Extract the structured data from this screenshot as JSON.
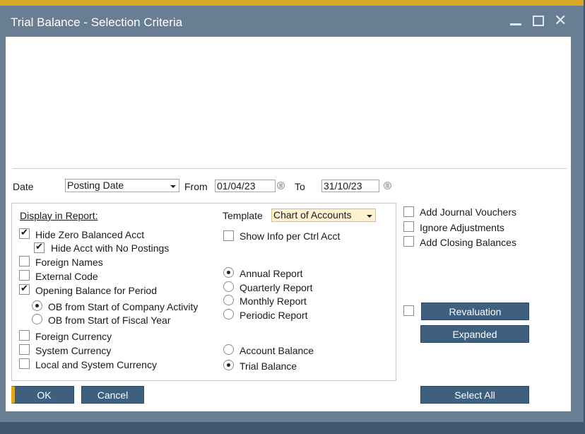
{
  "window": {
    "title": "Trial Balance - Selection Criteria",
    "accent_color": "#d6a823",
    "titlebar_color": "#687f93"
  },
  "date_row": {
    "date_label": "Date",
    "date_type": "Posting Date",
    "from_label": "From",
    "from_value": "01/04/23",
    "to_label": "To",
    "to_value": "31/10/23"
  },
  "display": {
    "heading": "Display in Report:",
    "hide_zero": {
      "label": "Hide Zero Balanced Acct",
      "checked": true
    },
    "hide_no_postings": {
      "label": "Hide Acct with No Postings",
      "checked": true
    },
    "foreign_names": {
      "label": "Foreign Names",
      "checked": false
    },
    "external_code": {
      "label": "External Code",
      "checked": false
    },
    "opening_balance": {
      "label": "Opening Balance for Period",
      "checked": true
    },
    "ob_company": {
      "label": "OB from Start of Company Activity",
      "selected": true
    },
    "ob_fiscal": {
      "label": "OB from Start of Fiscal Year",
      "selected": false
    },
    "foreign_currency": {
      "label": "Foreign Currency",
      "checked": false
    },
    "system_currency": {
      "label": "System Currency",
      "checked": false
    },
    "local_system_currency": {
      "label": "Local and System Currency",
      "checked": false
    }
  },
  "template": {
    "label": "Template",
    "value": "Chart of Accounts",
    "show_info": {
      "label": "Show Info per Ctrl Acct",
      "checked": false
    }
  },
  "report_period": {
    "annual": {
      "label": "Annual Report",
      "selected": true
    },
    "quarterly": {
      "label": "Quarterly Report",
      "selected": false
    },
    "monthly": {
      "label": "Monthly Report",
      "selected": false
    },
    "periodic": {
      "label": "Periodic Report",
      "selected": false
    }
  },
  "report_type": {
    "account_balance": {
      "label": "Account Balance",
      "selected": false
    },
    "trial_balance": {
      "label": "Trial Balance",
      "selected": true
    }
  },
  "options": {
    "add_journal_vouchers": {
      "label": "Add Journal Vouchers",
      "checked": false
    },
    "ignore_adjustments": {
      "label": "Ignore Adjustments",
      "checked": false
    },
    "add_closing_balances": {
      "label": "Add Closing Balances",
      "checked": false
    }
  },
  "buttons": {
    "revaluation": "Revaluation",
    "expanded": "Expanded",
    "ok": "OK",
    "cancel": "Cancel",
    "select_all": "Select All"
  }
}
